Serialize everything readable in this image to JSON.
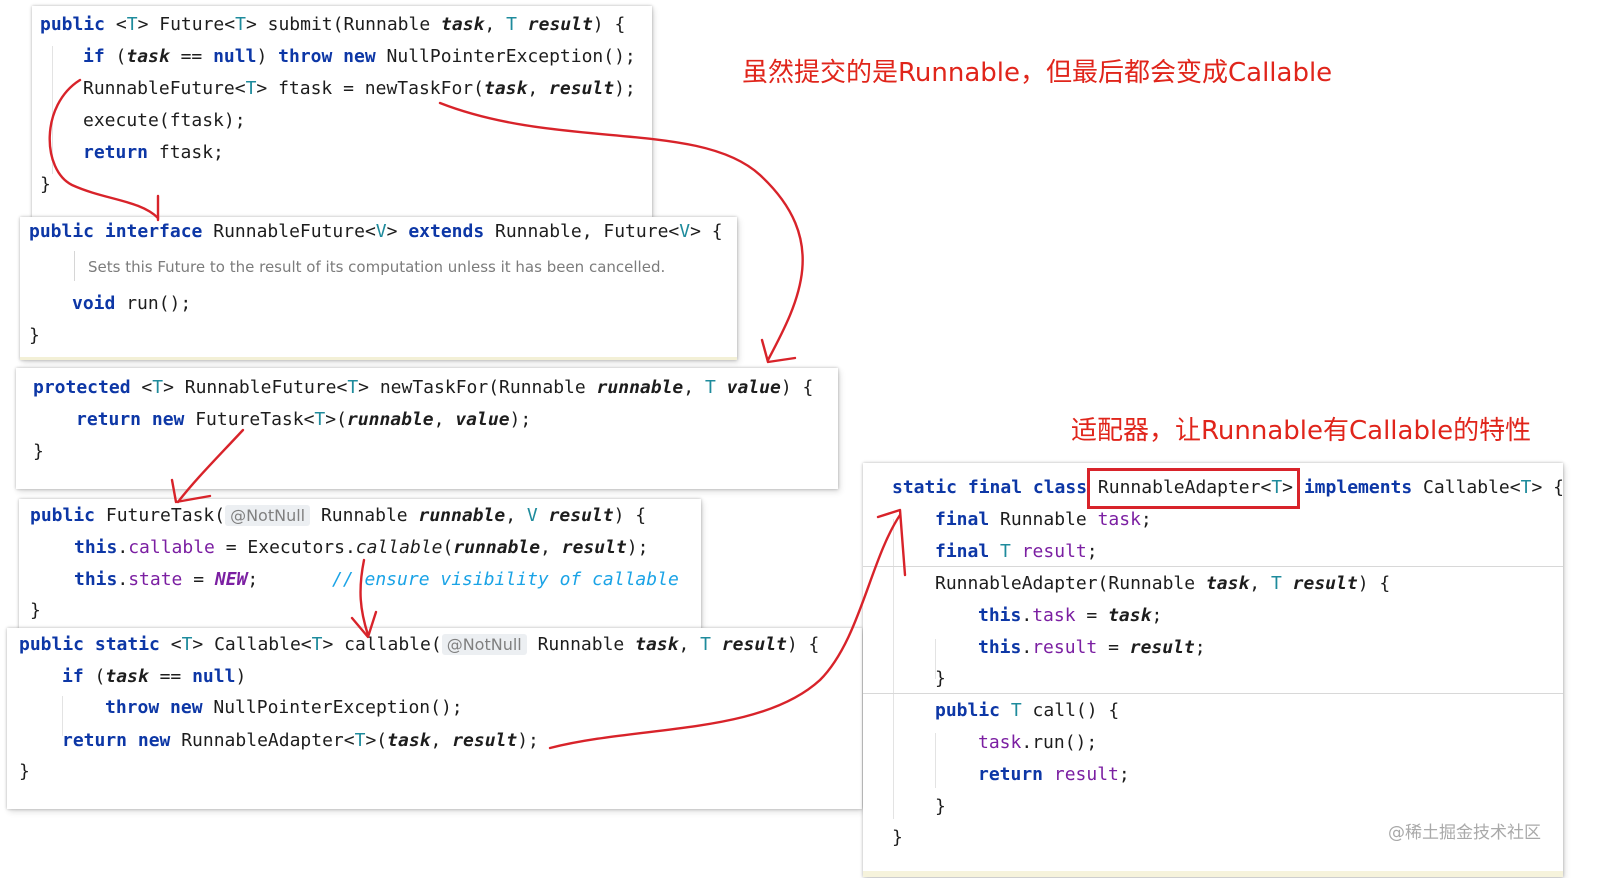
{
  "annotations": {
    "top_note": "虽然提交的是Runnable，但最后都会变成Callable",
    "adapter_note": "适配器，让Runnable有Callable的特性"
  },
  "watermark": "@稀土掘金技术社区",
  "colors": {
    "keyword": "#0d37a6",
    "type_param": "#1e8b9c",
    "field": "#7b1fa2",
    "comment": "#1aa3e6",
    "arrow": "#d8232a"
  },
  "submit_block": {
    "line1": {
      "p1": "public",
      "p2": " <",
      "p3": "T",
      "p4": "> Future<",
      "p5": "T",
      "p6": "> submit(Runnable ",
      "p7": "task",
      "p8": ", ",
      "p9": "T",
      "p10": " ",
      "p11": "result",
      "p12": ") {"
    },
    "line2": {
      "p1": "if",
      "p2": " (",
      "p3": "task",
      "p4": " == ",
      "p5": "null",
      "p6": ") ",
      "p7": "throw new",
      "p8": " NullPointerException();"
    },
    "line3": {
      "p1": "RunnableFuture<",
      "p2": "T",
      "p3": "> ftask = newTaskFor(",
      "p4": "task",
      "p5": ", ",
      "p6": "result",
      "p7": ");"
    },
    "line4": "execute(ftask);",
    "line5": {
      "p1": "return",
      "p2": " ftask;"
    },
    "line6": "}"
  },
  "runnable_future_block": {
    "line1": {
      "p1": "public interface",
      "p2": " RunnableFuture<",
      "p3": "V",
      "p4": "> ",
      "p5": "extends",
      "p6": " Runnable, Future<",
      "p7": "V",
      "p8": "> {"
    },
    "doc": "Sets this Future to the result of its computation unless it has been cancelled.",
    "line2": {
      "p1": "void",
      "p2": " run();"
    },
    "line3": "}"
  },
  "new_task_for_block": {
    "line1": {
      "p1": "protected",
      "p2": " <",
      "p3": "T",
      "p4": "> RunnableFuture<",
      "p5": "T",
      "p6": "> newTaskFor(Runnable ",
      "p7": "runnable",
      "p8": ", ",
      "p9": "T",
      "p10": " ",
      "p11": "value",
      "p12": ") {"
    },
    "line2": {
      "p1": "return new",
      "p2": " FutureTask<",
      "p3": "T",
      "p4": ">(",
      "p5": "runnable",
      "p6": ", ",
      "p7": "value",
      "p8": ");"
    },
    "line3": "}"
  },
  "future_task_block": {
    "line1": {
      "p1": "public",
      "p2": " FutureTask(",
      "ann": "@NotNull",
      "p3": " Runnable ",
      "p4": "runnable",
      "p5": ", ",
      "p6": "V",
      "p7": " ",
      "p8": "result",
      "p9": ") {"
    },
    "line2": {
      "p1": "this",
      "p2": ".",
      "p3": "callable",
      "p4": " = Executors.",
      "p5": "callable",
      "p6": "(",
      "p7": "runnable",
      "p8": ", ",
      "p9": "result",
      "p10": ");"
    },
    "line3": {
      "p1": "this",
      "p2": ".",
      "p3": "state",
      "p4": " = ",
      "p5": "NEW",
      "p6": ";",
      "comment": "// ensure visibility of callable"
    },
    "line4": "}"
  },
  "callable_block": {
    "line1": {
      "p1": "public static",
      "p2": " <",
      "p3": "T",
      "p4": "> Callable<",
      "p5": "T",
      "p6": "> callable(",
      "ann": "@NotNull",
      "p7": " Runnable ",
      "p8": "task",
      "p9": ", ",
      "p10": "T",
      "p11": " ",
      "p12": "result",
      "p13": ") {"
    },
    "line2": {
      "p1": "if",
      "p2": " (",
      "p3": "task",
      "p4": " == ",
      "p5": "null",
      "p6": ")"
    },
    "line3": {
      "p1": "throw new",
      "p2": " NullPointerException();"
    },
    "line4": {
      "p1": "return new",
      "p2": " RunnableAdapter<",
      "p3": "T",
      "p4": ">(",
      "p5": "task",
      "p6": ", ",
      "p7": "result",
      "p8": ");"
    },
    "line5": "}"
  },
  "adapter_block": {
    "line1": {
      "p1": "static final class",
      "p2": " ",
      "p3": "RunnableAdapter<",
      "p4": "T",
      "p5": ">",
      "p6": " ",
      "p7": "implements",
      "p8": " Callable<",
      "p9": "T",
      "p10": "> {"
    },
    "line2": {
      "p1": "final",
      "p2": " Runnable ",
      "p3": "task",
      "p4": ";"
    },
    "line3": {
      "p1": "final",
      "p2": " ",
      "p3": "T",
      "p4": " ",
      "p5": "result",
      "p6": ";"
    },
    "line4": {
      "p1": "RunnableAdapter(Runnable ",
      "p2": "task",
      "p3": ", ",
      "p4": "T",
      "p5": " ",
      "p6": "result",
      "p7": ") {"
    },
    "line5": {
      "p1": "this",
      "p2": ".",
      "p3": "task",
      "p4": " = ",
      "p5": "task",
      "p6": ";"
    },
    "line6": {
      "p1": "this",
      "p2": ".",
      "p3": "result",
      "p4": " = ",
      "p5": "result",
      "p6": ";"
    },
    "line7": "}",
    "line8": {
      "p1": "public",
      "p2": " ",
      "p3": "T",
      "p4": " call() {"
    },
    "line9": {
      "p1": "task",
      "p2": ".run();"
    },
    "line10": {
      "p1": "return",
      "p2": " ",
      "p3": "result",
      "p4": ";"
    },
    "line11": "}",
    "line12": "}"
  }
}
